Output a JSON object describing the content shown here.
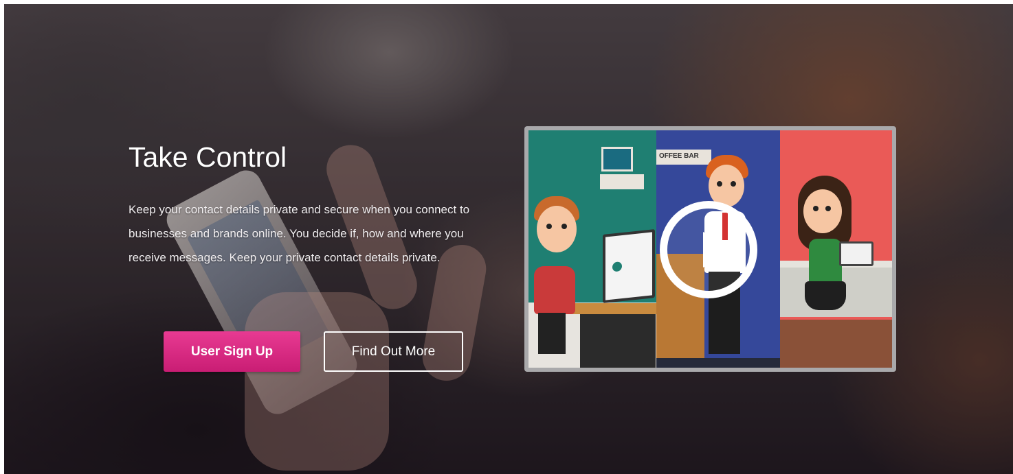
{
  "hero": {
    "headline": "Take Control",
    "description": "Keep your contact details private and secure when you connect to businesses and brands online. You decide if, how and where you receive messages. Keep your private contact details private.",
    "primary_button": "User Sign Up",
    "secondary_button": "Find Out More"
  },
  "video": {
    "play_icon": "play-icon",
    "preview_signage": [
      "OFFEE BAR"
    ]
  },
  "colors": {
    "primary_button": "#d92c83",
    "video_panel_teal": "#1f7f72",
    "video_panel_blue": "#35489a",
    "video_panel_red": "#ea5a57"
  }
}
